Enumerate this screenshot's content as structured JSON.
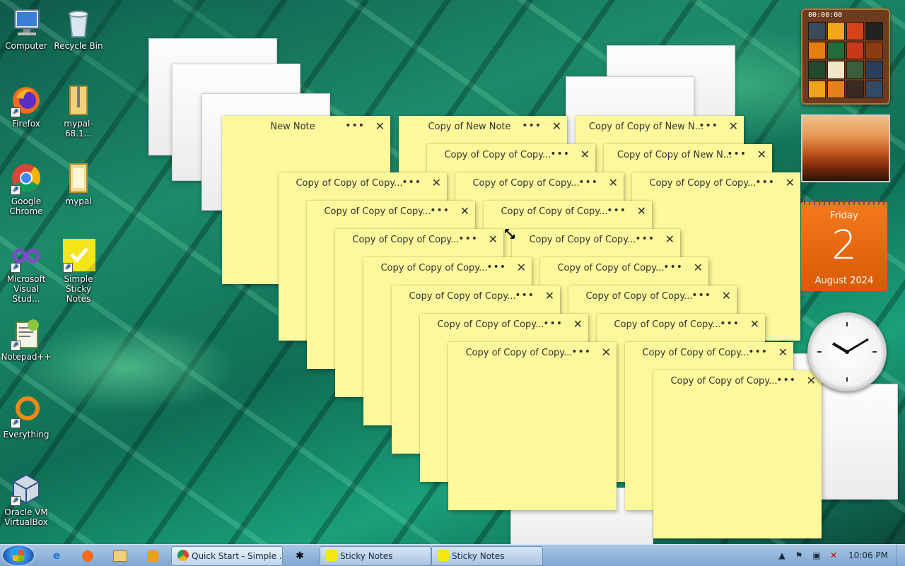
{
  "desktop_icons": [
    {
      "label": "Computer",
      "icon": "computer-icon"
    },
    {
      "label": "Recycle Bin",
      "icon": "recycle-bin-icon"
    },
    {
      "label": "Firefox",
      "icon": "firefox-icon"
    },
    {
      "label": "mypal-68.1...",
      "icon": "folder-zip-icon"
    },
    {
      "label": "Google Chrome",
      "icon": "chrome-icon"
    },
    {
      "label": "mypal",
      "icon": "folder-icon"
    },
    {
      "label": "Microsoft Visual Stud...",
      "icon": "visual-studio-icon"
    },
    {
      "label": "Simple Sticky Notes",
      "icon": "sticky-notes-icon"
    },
    {
      "label": "Notepad++",
      "icon": "notepad-plus-plus-icon"
    },
    {
      "label": "Everything",
      "icon": "everything-icon"
    },
    {
      "label": "Oracle VM VirtualBox",
      "icon": "virtualbox-icon"
    }
  ],
  "note_controls": {
    "more": "•••",
    "close": "✕"
  },
  "notes": [
    {
      "title": "New Note"
    },
    {
      "title": "Copy of New Note"
    },
    {
      "title": "Copy of Copy of New N..."
    },
    {
      "title": "Copy of Copy of Copy..."
    },
    {
      "title": "Copy of Copy of New N..."
    },
    {
      "title": "Copy of Copy of Copy..."
    },
    {
      "title": "Copy of Copy of Copy..."
    },
    {
      "title": "Copy of Copy of Copy..."
    },
    {
      "title": "Copy of Copy of Copy..."
    },
    {
      "title": "Copy of Copy of Copy..."
    },
    {
      "title": "Copy of Copy of Copy..."
    },
    {
      "title": "Copy of Copy of Copy..."
    },
    {
      "title": "Copy of Copy of Copy..."
    },
    {
      "title": "Copy of Copy of Copy..."
    },
    {
      "title": "Copy of Copy of Copy..."
    },
    {
      "title": "Copy of Copy of Copy..."
    },
    {
      "title": "Copy of Copy of Copy..."
    },
    {
      "title": "Copy of Copy of Copy..."
    },
    {
      "title": "Copy of Copy of Copy..."
    },
    {
      "title": "Copy of Copy of Copy..."
    },
    {
      "title": "Copy of Copy of Copy..."
    }
  ],
  "gadgets": {
    "puzzle_timer": "00:00:00",
    "calendar": {
      "weekday": "Friday",
      "day": "2",
      "month_year": "August 2024"
    }
  },
  "taskbar": {
    "buttons": [
      {
        "label": "Quick Start - Simple ...",
        "icon": "chrome-icon"
      },
      {
        "label": "Sticky Notes",
        "icon": "sticky-notes-icon"
      },
      {
        "label": "Sticky Notes",
        "icon": "sticky-notes-icon"
      }
    ],
    "clock": "10:06 PM"
  }
}
